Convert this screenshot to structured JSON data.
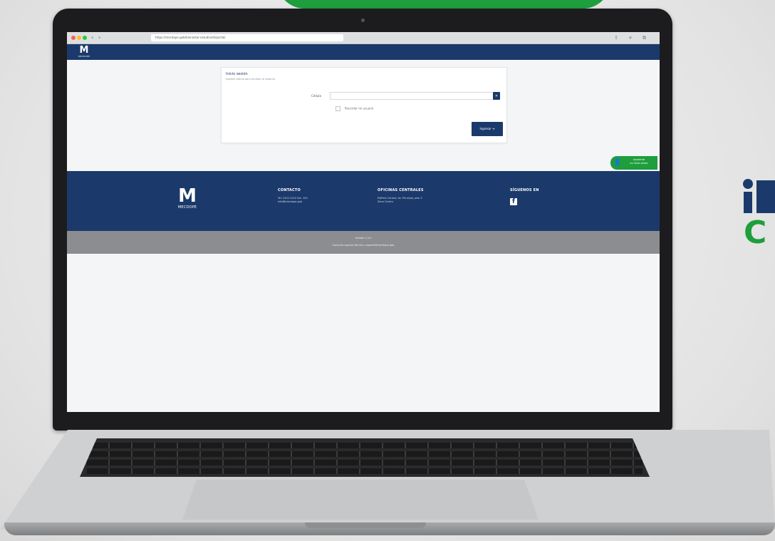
{
  "browser": {
    "url": "https://mecdope.gob/bienestar-estudiantil/portal/",
    "back": "‹",
    "forward": "›",
    "controls": [
      "⇧",
      "+",
      "⧉"
    ],
    "traffic_lights": [
      "#ff5f57",
      "#ffbd2e",
      "#28c840"
    ]
  },
  "header": {
    "logo_mark": "M",
    "logo_text": "MECDOPE"
  },
  "form": {
    "title": "Inicio sesión",
    "subtitle": "Ingrese cédula para acceder al sistema",
    "field_label": "Cédula",
    "field_value": "",
    "field_button": "»",
    "checkbox_label": "Recordar mi usuario",
    "submit_label": "Ingresar ➜"
  },
  "chat": {
    "icon": "👤",
    "line1": "Asistente",
    "line2": "en línea ahora"
  },
  "footer": {
    "logo_mark": "M",
    "logo_text": "MECDOPE",
    "contacts_title": "CONTACTO",
    "contacts_lines": [
      "Tel: 2222-2222 Ext. 100",
      "info@mecdope.gob"
    ],
    "offices_title": "OFICINAS CENTRALES",
    "offices_lines": [
      "Edificio Central, Av. Principal, piso 3",
      "Zona Centro"
    ],
    "follow_title": "SÍGUENOS EN",
    "facebook_icon": "f"
  },
  "bottom_bar": {
    "line1": "Versión 1.0.0",
    "line2": "Contacto soporte técnico: soporte@mecdope.gob"
  },
  "colors": {
    "brand_navy": "#1b3a6b",
    "brand_green": "#1e9e3c",
    "footer_gray": "#8b8d90"
  }
}
